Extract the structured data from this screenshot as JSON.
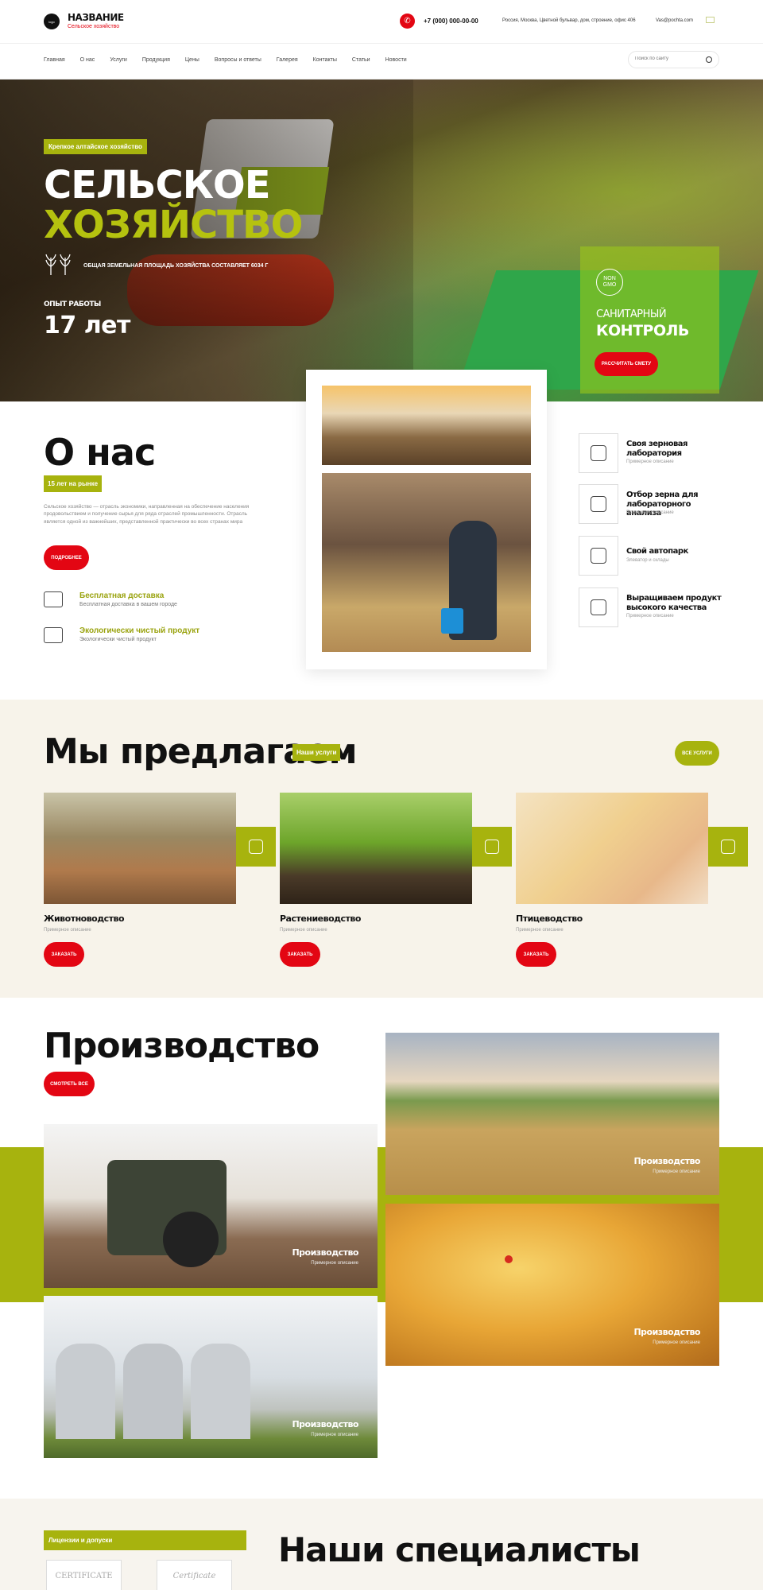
{
  "header": {
    "logo_text": "logo",
    "brand_name": "НАЗВАНИЕ",
    "brand_sub": "Сельское хозяйство",
    "phone": "+7 (000) 000-00-00",
    "address": "Россия, Москва, Цветной бульвар, дом, строение, офис 406",
    "email": "Vas@pochta.com"
  },
  "nav": {
    "items": [
      "Главная",
      "О нас",
      "Услуги",
      "Продукция",
      "Цены",
      "Вопросы и ответы",
      "Галерея",
      "Контакты",
      "Статьи",
      "Новости"
    ],
    "search_placeholder": "Поиск по сайту"
  },
  "hero": {
    "tag": "Крепкое алтайское хозяйство",
    "title_line1": "СЕЛЬСКОЕ",
    "title_line2": "ХОЗЯЙСТВО",
    "area_text": "ОБЩАЯ ЗЕМЕЛЬНАЯ ПЛОЩАДЬ ХОЗЯЙСТВА СОСТАВЛЯЕТ 6034 Г",
    "experience_label": "ОПЫТ РАБОТЫ",
    "experience_value": "17 лет",
    "gmo_badge": "NON GMO",
    "gmo_title1": "САНИТАРНЫЙ",
    "gmo_title2": "КОНТРОЛЬ",
    "gmo_button": "РАССЧИТАТЬ СМЕТУ"
  },
  "about": {
    "title": "О нас",
    "badge": "15 лет на рынке",
    "description": "Сельское хозяйство — отрасль экономики, направленная на обеспечение населения продовольствием и получение сырья для ряда отраслей промышленности. Отрасль является одной из важнейших, представленной практически во всех странах мира",
    "button": "ПОДРОБНЕЕ",
    "features": [
      {
        "title": "Бесплатная доставка",
        "sub": "Бесплатная доставка в вашем городе"
      },
      {
        "title": "Экологически чистый продукт",
        "sub": "Экологически чистый продукт"
      }
    ],
    "services": [
      {
        "title": "Своя зерновая лаборатория",
        "sub": "Примерное описание"
      },
      {
        "title": "Отбор зерна для лабораторного анализа",
        "sub": "Примерное описание"
      },
      {
        "title": "Свой автопарк",
        "sub": "Элеватор и склады"
      },
      {
        "title": "Выращиваем продукт высокого качества",
        "sub": "Примерное описание"
      }
    ]
  },
  "offer": {
    "title": "Мы предлагаем",
    "badge": "Наши услуги",
    "all_button": "ВСЕ УСЛУГИ",
    "cards": [
      {
        "title": "Животноводство",
        "sub": "Примерное описание",
        "button": "ЗАКАЗАТЬ"
      },
      {
        "title": "Растениеводство",
        "sub": "Примерное описание",
        "button": "ЗАКАЗАТЬ"
      },
      {
        "title": "Птицеводство",
        "sub": "Примерное описание",
        "button": "ЗАКАЗАТЬ"
      }
    ]
  },
  "production": {
    "title": "Производство",
    "button": "СМОТРЕТЬ ВСЕ",
    "tiles": [
      {
        "title": "Производство",
        "sub": "Примерное описание"
      },
      {
        "title": "Производство",
        "sub": "Примерное описание"
      },
      {
        "title": "Производство",
        "sub": "Примерное описание"
      },
      {
        "title": "Производство",
        "sub": "Примерное описание"
      }
    ]
  },
  "bottom": {
    "licenses": "Лицензии и допуски",
    "cert1": "CERTIFICATE",
    "cert2": "Certificate",
    "specialists": "Наши специалисты"
  }
}
